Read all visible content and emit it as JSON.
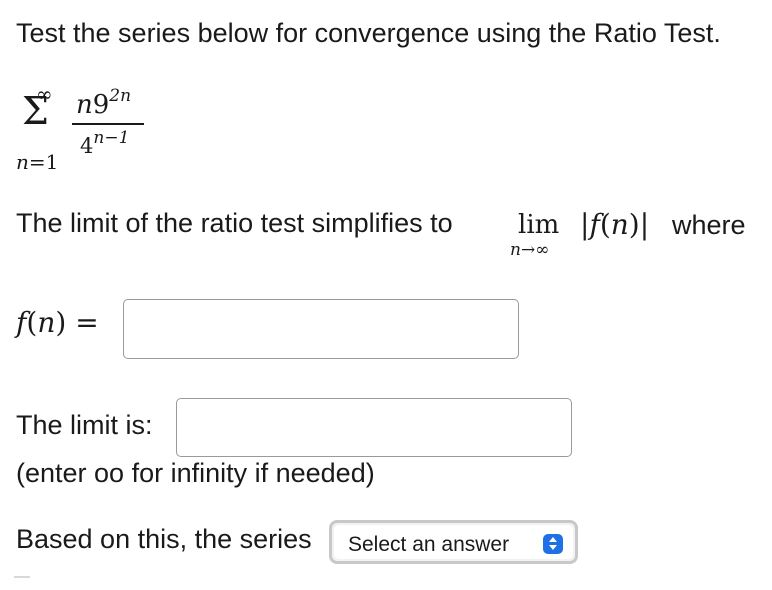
{
  "question": "Test the series below for convergence using the Ratio Test.",
  "series": {
    "upper_limit": "∞",
    "sigma": "Σ",
    "lower_var": "n",
    "lower_eq": "=1",
    "num_var": "n",
    "num_base": "9",
    "num_exp": "2n",
    "den_base": "4",
    "den_exp": "n−1"
  },
  "limit_text": {
    "intro": "The limit of the ratio test simplifies to",
    "lim": "lim",
    "lim_sub": "n→∞",
    "abs_open": "|",
    "f": "f",
    "paren_open": "(",
    "var": "n",
    "paren_close": ")",
    "abs_close": "|",
    "where": "where"
  },
  "fn_row": {
    "f": "f",
    "paren_open": "(",
    "var": "n",
    "paren_close": ")",
    "equals": " =",
    "input_value": ""
  },
  "limit_row": {
    "label": "The limit is:",
    "input_value": "",
    "hint": "(enter oo for infinity if needed)"
  },
  "conclusion": {
    "label": "Based on this, the series",
    "select_value": "Select an answer"
  },
  "colors": {
    "select_arrow_bg": "#1f6fe5",
    "input_border": "#9a9a9a"
  },
  "icons": {
    "select_arrows": "up-down-chevron-icon"
  }
}
